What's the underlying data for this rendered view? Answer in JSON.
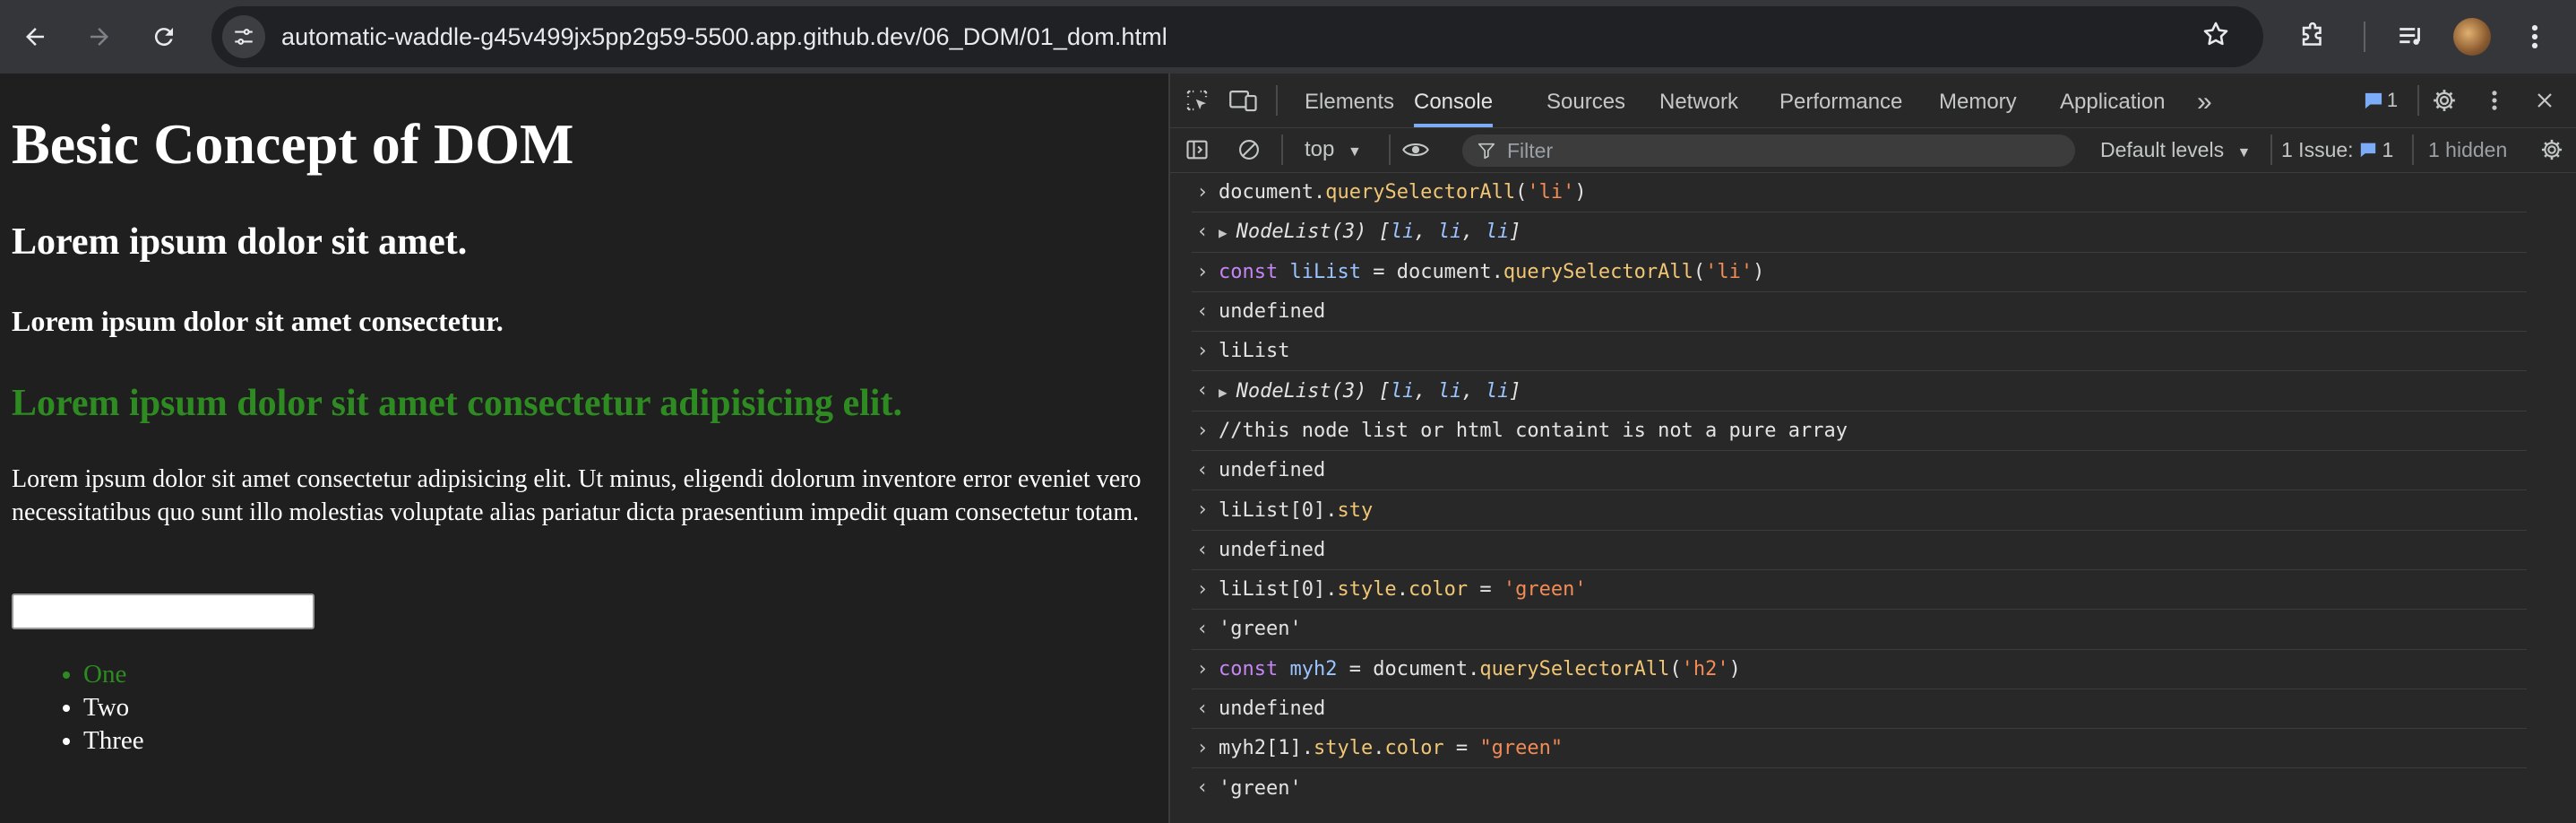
{
  "browser": {
    "url": "automatic-waddle-g45v499jx5pp2g59-5500.app.github.dev/06_DOM/01_dom.html"
  },
  "page": {
    "h1": "Besic Concept of DOM",
    "h2_first": "Lorem ipsum dolor sit amet.",
    "h3": "Lorem ipsum dolor sit amet consectetur.",
    "h2_second": "Lorem ipsum dolor sit amet consectetur adipisicing elit.",
    "paragraph": "Lorem ipsum dolor sit amet consectetur adipisicing elit. Ut minus, eligendi dolorum inventore error eveniet vero necessitatibus quo sunt illo molestias voluptate alias pariatur dicta praesentium impedit quam consectetur totam.",
    "input_value": "",
    "list": [
      "One",
      "Two",
      "Three"
    ],
    "colors": {
      "green": "#2e8b22",
      "background": "#1f1f1f"
    }
  },
  "devtools": {
    "tabs": [
      "Elements",
      "Console",
      "Sources",
      "Network",
      "Performance",
      "Memory",
      "Application"
    ],
    "active_tab": "Console",
    "message_count": "1",
    "context": "top",
    "filter_placeholder": "Filter",
    "levels": "Default levels",
    "issues_label": "1 Issue:",
    "issues_count": "1",
    "hidden": "1 hidden",
    "console": {
      "r1": {
        "p1": "document.",
        "p2": "querySelectorAll",
        "p3": "(",
        "p4": "'li'",
        "p5": ")"
      },
      "r2": {
        "label": "NodeList(3) [",
        "li1": "li",
        "li2": "li",
        "li3": "li",
        "sep": ", ",
        "end": "]"
      },
      "r3": {
        "kw": "const",
        "var": "liList",
        "eq": " = document.",
        "fn": "querySelectorAll",
        "p": "(",
        "str": "'li'",
        "end": ")"
      },
      "r4": "undefined",
      "r5": "liList",
      "r6": {
        "label": "NodeList(3) [",
        "li1": "li",
        "li2": "li",
        "li3": "li",
        "sep": ", ",
        "end": "]"
      },
      "r7": "//this node list or html containt is not a pure array",
      "r8": "undefined",
      "r9": {
        "a": "liList[0].",
        "b": "sty"
      },
      "r10": "undefined",
      "r11": {
        "a": "liList[0].",
        "b": "style",
        "c": ".",
        "d": "color",
        "e": " = ",
        "f": "'green'"
      },
      "r12": "'green'",
      "r13": {
        "kw": "const",
        "var": "myh2",
        "eq": " = document.",
        "fn": "querySelectorAll",
        "p": "(",
        "str": "'h2'",
        "end": ")"
      },
      "r14": "undefined",
      "r15": {
        "a": "myh2[1].",
        "b": "style",
        "c": ".",
        "d": "color",
        "e": " = ",
        "f": "\"green\""
      },
      "r16": "'green'"
    }
  }
}
